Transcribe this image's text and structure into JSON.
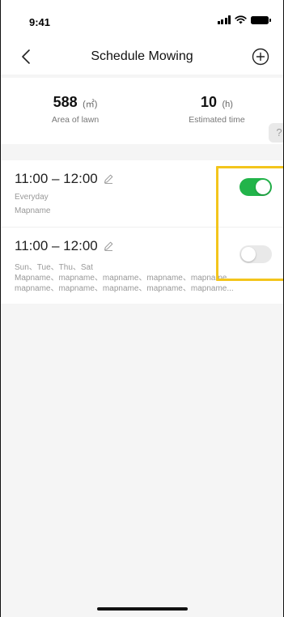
{
  "status_bar": {
    "time": "9:41"
  },
  "nav": {
    "title": "Schedule Mowing",
    "back_icon": "chevron-left-icon",
    "add_icon": "plus-circle-icon"
  },
  "stats": {
    "area": {
      "value": "588",
      "unit": "(㎡)",
      "label": "Area of lawn"
    },
    "estimated": {
      "value": "10",
      "unit": "(h)",
      "label": "Estimated  time"
    },
    "help": "?"
  },
  "schedules": [
    {
      "time": "11:00 – 12:00",
      "days": "Everyday",
      "maps": [
        "Mapname"
      ],
      "enabled": true
    },
    {
      "time": "11:00 – 12:00",
      "days": "Sun、Tue、Thu、Sat",
      "maps": [
        "Mapname、mapname、mapname、mapname、mapname、",
        "mapname、mapname、mapname、mapname、mapname..."
      ],
      "enabled": false
    }
  ],
  "colors": {
    "toggle_on": "#22b44a",
    "highlight": "#f3c51c",
    "background": "#f5f5f5"
  }
}
